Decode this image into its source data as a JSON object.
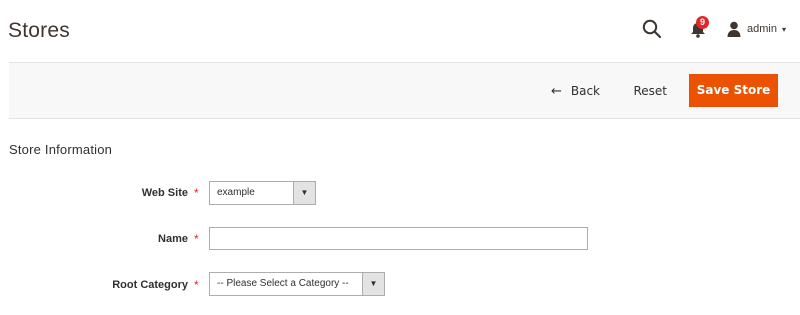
{
  "header": {
    "page_title": "Stores",
    "notifications_count": "9",
    "admin_name": "admin",
    "admin_caret": "▾"
  },
  "actions": {
    "back_icon": "←",
    "back_label": "Back",
    "reset_label": "Reset",
    "save_label": "Save Store",
    "save_color": "#eb5202"
  },
  "form": {
    "section_title": "Store Information",
    "required_marker": "*",
    "website": {
      "label": "Web Site",
      "value": "example",
      "arrow": "▼"
    },
    "name": {
      "label": "Name",
      "value": "",
      "placeholder": ""
    },
    "root_category": {
      "label": "Root Category",
      "value": "-- Please Select a Category --",
      "arrow": "▼"
    }
  },
  "icons": {
    "search": "search-icon",
    "notifications": "bell-icon",
    "user": "user-icon"
  }
}
